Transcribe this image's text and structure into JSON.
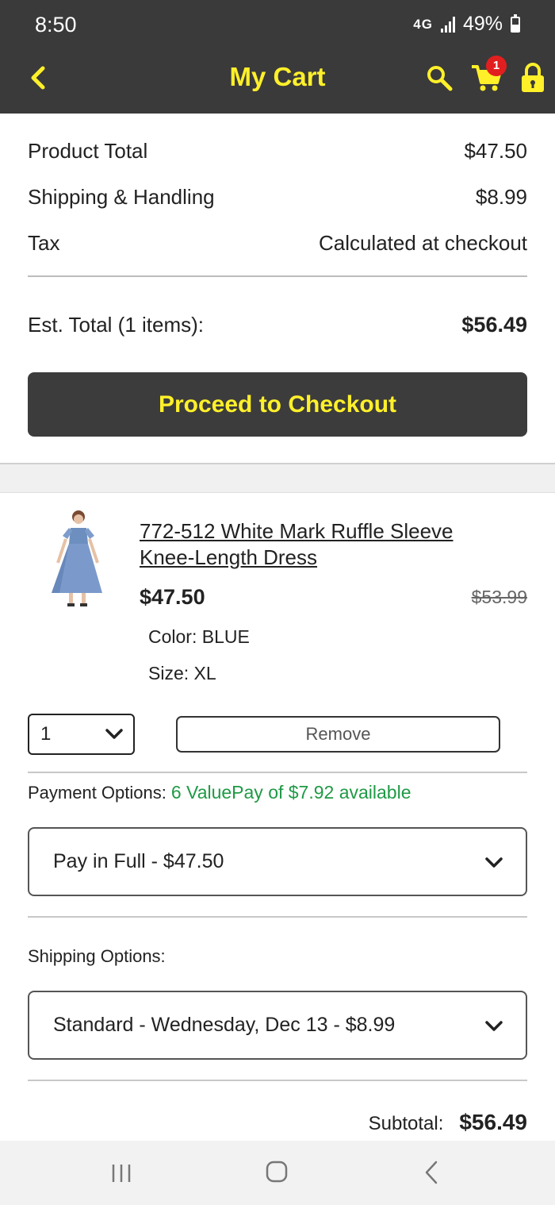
{
  "status_bar": {
    "time": "8:50",
    "network": "4G",
    "battery_text": "49%",
    "battery_level_percent": 49
  },
  "header": {
    "title": "My Cart",
    "cart_badge": "1",
    "icons": [
      "back-chevron-icon",
      "search-icon",
      "cart-icon",
      "lock-icon"
    ],
    "accent_color": "#fff02a",
    "background_color": "#3a3a3a"
  },
  "summary": {
    "rows": [
      {
        "label": "Product Total",
        "value": "$47.50"
      },
      {
        "label": "Shipping & Handling",
        "value": "$8.99"
      },
      {
        "label": "Tax",
        "value": "Calculated at checkout"
      }
    ],
    "est_total_label": "Est. Total (1 items):",
    "est_total_value": "$56.49",
    "checkout_label": "Proceed to Checkout"
  },
  "item": {
    "name": "772-512 White Mark Ruffle Sleeve Knee-Length Dress",
    "price": "$47.50",
    "original_price": "$53.99",
    "color_text": "Color: BLUE",
    "size_text": "Size: XL",
    "quantity": "1",
    "remove_label": "Remove",
    "payment_label": "Payment Options:",
    "valuepay_text": "6 ValuePay of $7.92 available",
    "payment_selected": "Pay in Full - $47.50",
    "shipping_label": "Shipping Options:",
    "shipping_selected": "Standard - Wednesday, Dec 13 - $8.99",
    "subtotal_label": "Subtotal:",
    "subtotal_value": "$56.49"
  },
  "nav": {
    "icons": [
      "recent-apps-icon",
      "home-icon",
      "back-icon"
    ]
  }
}
